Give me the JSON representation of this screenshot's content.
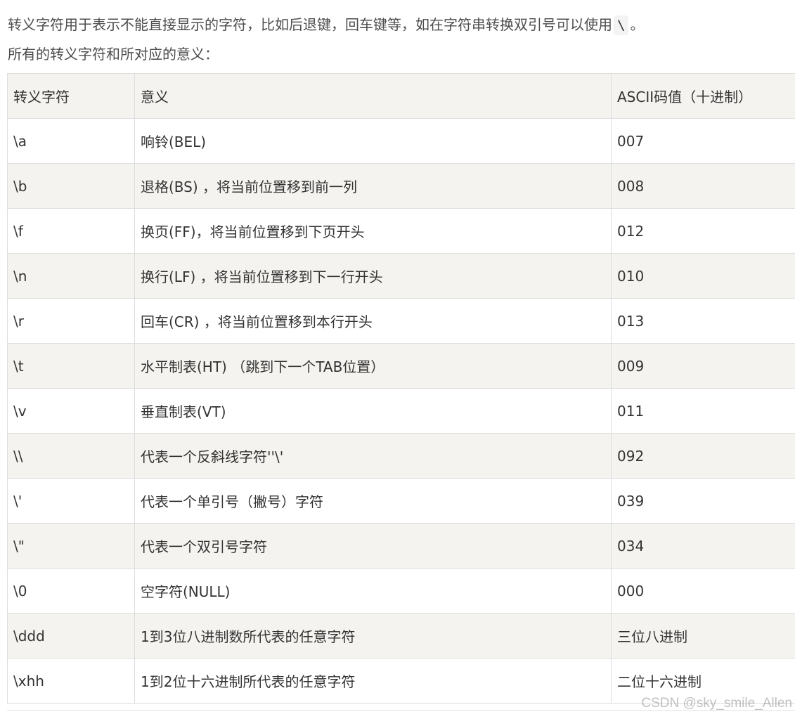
{
  "intro": {
    "line1_text": "转义字符用于表示不能直接显示的字符，比如后退键，回车键等，如在字符串转换双引号可以使用",
    "line1_code": "\\",
    "line1_end": "。",
    "line2": "所有的转义字符和所对应的意义："
  },
  "table": {
    "headers": [
      "转义字符",
      "意义",
      "ASCII码值（十进制）"
    ],
    "rows": [
      [
        "\\a",
        "响铃(BEL)",
        "007"
      ],
      [
        "\\b",
        "退格(BS) ，将当前位置移到前一列",
        "008"
      ],
      [
        "\\f",
        "换页(FF)，将当前位置移到下页开头",
        "012"
      ],
      [
        "\\n",
        "换行(LF) ，将当前位置移到下一行开头",
        "010"
      ],
      [
        "\\r",
        "回车(CR) ，将当前位置移到本行开头",
        "013"
      ],
      [
        "\\t",
        "水平制表(HT) （跳到下一个TAB位置）",
        "009"
      ],
      [
        "\\v",
        "垂直制表(VT)",
        "011"
      ],
      [
        "\\\\",
        "代表一个反斜线字符''\\'",
        "092"
      ],
      [
        "\\'",
        "代表一个单引号（撇号）字符",
        "039"
      ],
      [
        "\\\"",
        "代表一个双引号字符",
        "034"
      ],
      [
        "\\0",
        "空字符(NULL)",
        "000"
      ],
      [
        "\\ddd",
        "1到3位八进制数所代表的任意字符",
        "三位八进制"
      ],
      [
        "\\xhh",
        "1到2位十六进制所代表的任意字符",
        "二位十六进制"
      ]
    ]
  },
  "watermark": "CSDN @sky_smile_Allen"
}
